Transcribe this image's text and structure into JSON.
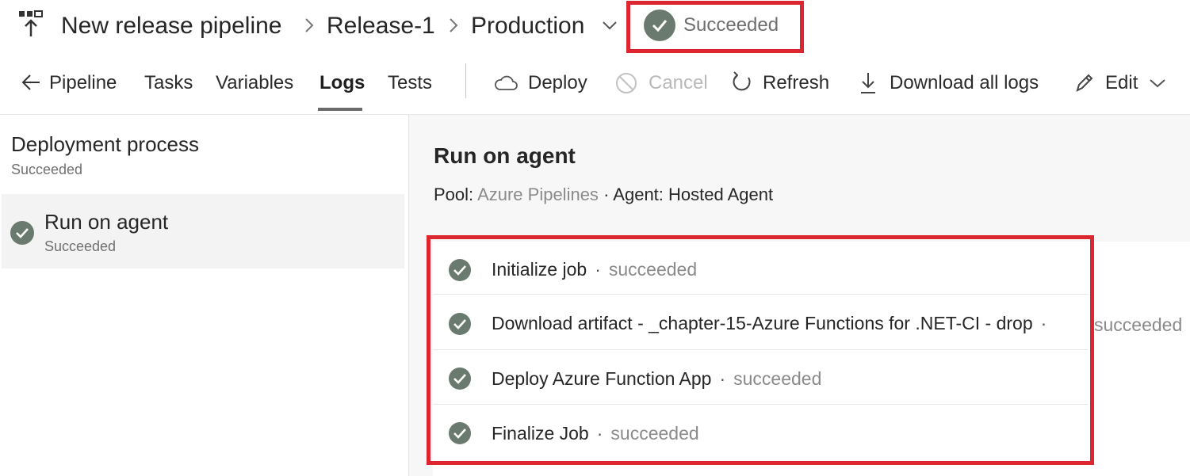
{
  "breadcrumb": {
    "pipeline": "New release pipeline",
    "release": "Release-1",
    "stage": "Production",
    "status": "Succeeded"
  },
  "toolbar": {
    "tabs": [
      {
        "label": "Pipeline",
        "icon": "arrow-left-icon"
      },
      {
        "label": "Tasks"
      },
      {
        "label": "Variables"
      },
      {
        "label": "Logs",
        "active": true
      },
      {
        "label": "Tests"
      }
    ],
    "actions": [
      {
        "label": "Deploy",
        "icon": "cloud-icon"
      },
      {
        "label": "Cancel",
        "icon": "cancel-icon",
        "disabled": true
      },
      {
        "label": "Refresh",
        "icon": "refresh-icon"
      },
      {
        "label": "Download all logs",
        "icon": "download-icon"
      },
      {
        "label": "Edit",
        "icon": "pencil-icon"
      }
    ]
  },
  "left_pane": {
    "title": "Deployment process",
    "status": "Succeeded",
    "jobs": [
      {
        "name": "Run on agent",
        "status": "Succeeded"
      }
    ]
  },
  "right_pane": {
    "title": "Run on agent",
    "pool_label": "Pool:",
    "pool_value": "Azure Pipelines",
    "separator": "·",
    "agent_label": "Agent: Hosted Agent",
    "steps": [
      {
        "name": "Initialize job",
        "status": "succeeded"
      },
      {
        "name": "Download artifact - _chapter-15-Azure Functions for .NET-CI - drop",
        "status": "succeeded"
      },
      {
        "name": "Deploy Azure Function App",
        "status": "succeeded"
      },
      {
        "name": "Finalize Job",
        "status": "succeeded"
      }
    ]
  },
  "colors": {
    "highlight": "#dd2730",
    "success_icon": "#6b7a6e",
    "selected_row": "#f3f3f3"
  }
}
